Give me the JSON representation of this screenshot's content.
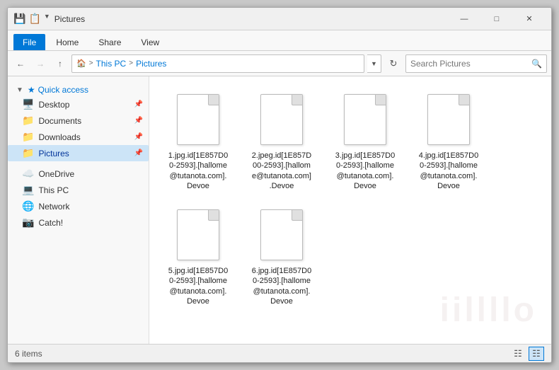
{
  "window": {
    "title": "Pictures",
    "title_icon": "📁"
  },
  "ribbon": {
    "tabs": [
      "File",
      "Home",
      "Share",
      "View"
    ],
    "active_tab": "File"
  },
  "address_bar": {
    "back_disabled": false,
    "forward_disabled": true,
    "path_parts": [
      "This PC",
      "Pictures"
    ],
    "search_placeholder": "Search Pictures"
  },
  "sidebar": {
    "quick_access_label": "Quick access",
    "items": [
      {
        "label": "Desktop",
        "pinned": true,
        "type": "desktop",
        "active": false
      },
      {
        "label": "Documents",
        "pinned": true,
        "type": "documents",
        "active": false
      },
      {
        "label": "Downloads",
        "pinned": true,
        "type": "downloads",
        "active": false
      },
      {
        "label": "Pictures",
        "pinned": true,
        "type": "pictures",
        "active": true
      }
    ],
    "other_items": [
      {
        "label": "OneDrive",
        "type": "onedrive"
      },
      {
        "label": "This PC",
        "type": "pc"
      },
      {
        "label": "Network",
        "type": "network"
      },
      {
        "label": "Catch!",
        "type": "catch"
      }
    ]
  },
  "files": [
    {
      "name": "1.jpg.id[1E857D00-2593].[hallome@tutanota.com].Devoe",
      "short_name": "1.jpg.id[1E857D0\n0-2593].[hallome\n@tutanota.com].\nDevoe"
    },
    {
      "name": "2.jpeg.id[1E857D00-2593].[hallome@tutanota.com].Devoe",
      "short_name": "2.jpeg.id[1E857D\n00-2593].[hallom\ne@tutanota.com]\n.Devoe"
    },
    {
      "name": "3.jpg.id[1E857D00-2593].[hallome@tutanota.com].Devoe",
      "short_name": "3.jpg.id[1E857D0\n0-2593].[hallome\n@tutanota.com].\nDevoe"
    },
    {
      "name": "4.jpg.id[1E857D00-2593].[hallome@tutanota.com].Devoe",
      "short_name": "4.jpg.id[1E857D0\n0-2593].[hallome\n@tutanota.com].\nDevoe"
    },
    {
      "name": "5.jpg.id[1E857D00-2593].[hallome@tutanota.com].Devoe",
      "short_name": "5.jpg.id[1E857D0\n0-2593].[hallome\n@tutanota.com].\nDevoe"
    },
    {
      "name": "6.jpg.id[1E857D00-2593].[hallome@tutanota.com].Devoe",
      "short_name": "6.jpg.id[1E857D0\n0-2593].[hallome\n@tutanota.com].\nDevoe"
    }
  ],
  "status_bar": {
    "item_count": "6 items"
  },
  "colors": {
    "accent": "#0078d7",
    "title_bg": "#f0f0f0",
    "active_tab_bg": "#0078d7"
  }
}
